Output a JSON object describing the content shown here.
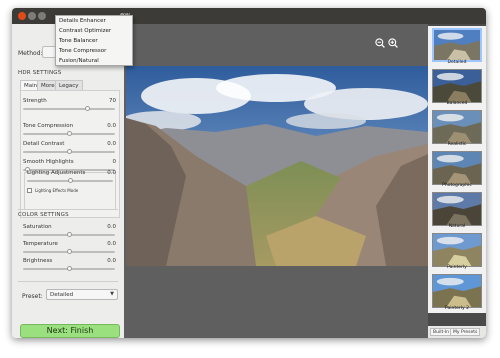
{
  "window": {
    "title": "ew"
  },
  "method": {
    "label": "Method:",
    "options": [
      "Details Enhancer",
      "Contrast Optimizer",
      "Tone Balancer",
      "Tone Compressor",
      "Fusion/Natural"
    ]
  },
  "hdr": {
    "title": "HDR SETTINGS",
    "tabs": [
      "Main",
      "More",
      "Legacy"
    ],
    "sliders": [
      {
        "label": "Strength",
        "value": "70",
        "pos": 0.7
      },
      {
        "label": "Tone Compression",
        "value": "0.0",
        "pos": 0.5
      },
      {
        "label": "Detail Contrast",
        "value": "0.0",
        "pos": 0.5
      },
      {
        "label": "Smooth Highlights",
        "value": "0",
        "pos": 0.05
      }
    ],
    "lighting": {
      "label": "Lighting Adjustments",
      "value": "0.0",
      "pos": 0.5,
      "checkbox_label": "Lighting Effects Mode"
    }
  },
  "color": {
    "title": "COLOR SETTINGS",
    "sliders": [
      {
        "label": "Saturation",
        "value": "0.0",
        "pos": 0.5
      },
      {
        "label": "Temperature",
        "value": "0.0",
        "pos": 0.5
      },
      {
        "label": "Brightness",
        "value": "0.0",
        "pos": 0.5
      }
    ]
  },
  "preset": {
    "label": "Preset:",
    "value": "Detailed"
  },
  "next_button": "Next: Finish",
  "presets": [
    "Detailed",
    "Balanced",
    "Realistic",
    "Photographic",
    "Natural",
    "Painterly",
    "Painterly 2"
  ],
  "preset_tabs": [
    "Built-In",
    "My Presets"
  ],
  "colors": {
    "accent_green": "#9ae07e",
    "titlebar": "#3c3b37",
    "close": "#df4b16"
  },
  "icons": [
    "zoom-out-icon",
    "zoom-in-icon",
    "dropdown-arrow-icon"
  ]
}
